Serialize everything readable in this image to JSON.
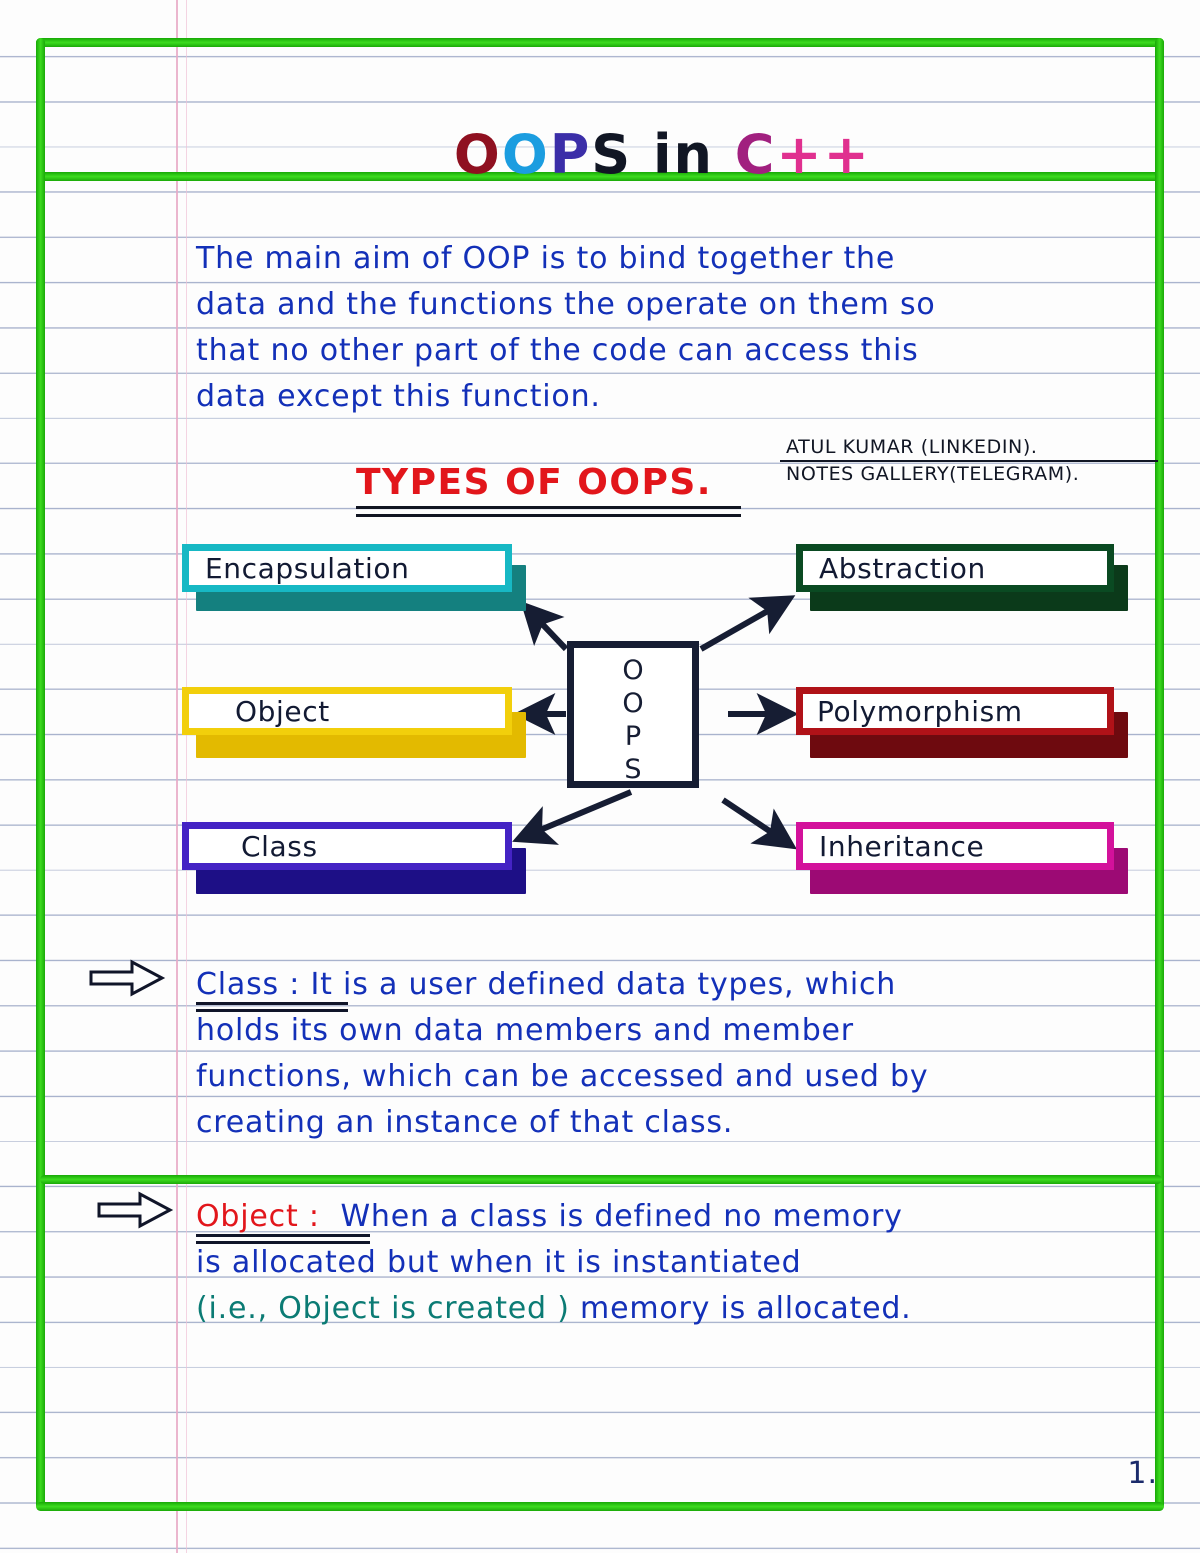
{
  "page": {
    "title_parts": [
      {
        "text": "O",
        "color": "#8f1020"
      },
      {
        "text": "O",
        "color": "#1b9de0"
      },
      {
        "text": "P",
        "color": "#3b2ea8"
      },
      {
        "text": "S",
        "color": "#111624"
      },
      {
        "text": " in ",
        "color": "#111624"
      },
      {
        "text": "C",
        "color": "#a1207f"
      },
      {
        "text": "++",
        "color": "#e0308f"
      }
    ],
    "title_plain": "OOPS in C++",
    "page_number": "1.",
    "frame_color": "#2bc413",
    "ink_color": "#1330b8",
    "accent_red": "#e2161b"
  },
  "intro": {
    "lines": [
      "The main aim of OOP is to bind together the",
      "data and the functions the operate on them so",
      "that no other part of the code can access this",
      "data except this function."
    ]
  },
  "section": {
    "heading": "TYPES OF OOPS.",
    "heading_color": "#e2161b"
  },
  "credits": {
    "line1": "ATUL KUMAR (LINKEDIN).",
    "line2": "NOTES GALLERY(TELEGRAM)."
  },
  "diagram": {
    "center_label": "OOPS",
    "center_letters": [
      "O",
      "O",
      "P",
      "S"
    ],
    "nodes": [
      {
        "id": "encapsulation",
        "label": "Encapsulation",
        "border": "#17b8c4",
        "shadow": "#14807f",
        "side": "left",
        "row": 1
      },
      {
        "id": "abstraction",
        "label": "Abstraction",
        "border": "#0a4a22",
        "shadow": "#0b3a1a",
        "side": "right",
        "row": 1
      },
      {
        "id": "object",
        "label": "Object",
        "border": "#f2cf0b",
        "shadow": "#e3ba00",
        "side": "left",
        "row": 2
      },
      {
        "id": "polymorphism",
        "label": "Polymorphism",
        "border": "#b01218",
        "shadow": "#6e0a0f",
        "side": "right",
        "row": 2
      },
      {
        "id": "class",
        "label": "Class",
        "border": "#4423c4",
        "shadow": "#1d0f86",
        "side": "left",
        "row": 3
      },
      {
        "id": "inheritance",
        "label": "Inheritance",
        "border": "#d3119b",
        "shadow": "#9c0a74",
        "side": "right",
        "row": 3
      }
    ]
  },
  "definitions": {
    "class": {
      "term": "Class :",
      "lines": [
        "It is a user defined data types, which",
        "holds its own data members and member",
        "functions, which can be accessed and used by",
        "creating an instance of that class."
      ]
    },
    "object": {
      "term": "Object :",
      "lines": [
        "When a class is defined no memory",
        "is allocated but when it is instantiated",
        "(i.e., Object is created ) memory is allocated."
      ],
      "line3_teal": "(i.e., Object is created )",
      "line3_blue": " memory is allocated."
    }
  }
}
